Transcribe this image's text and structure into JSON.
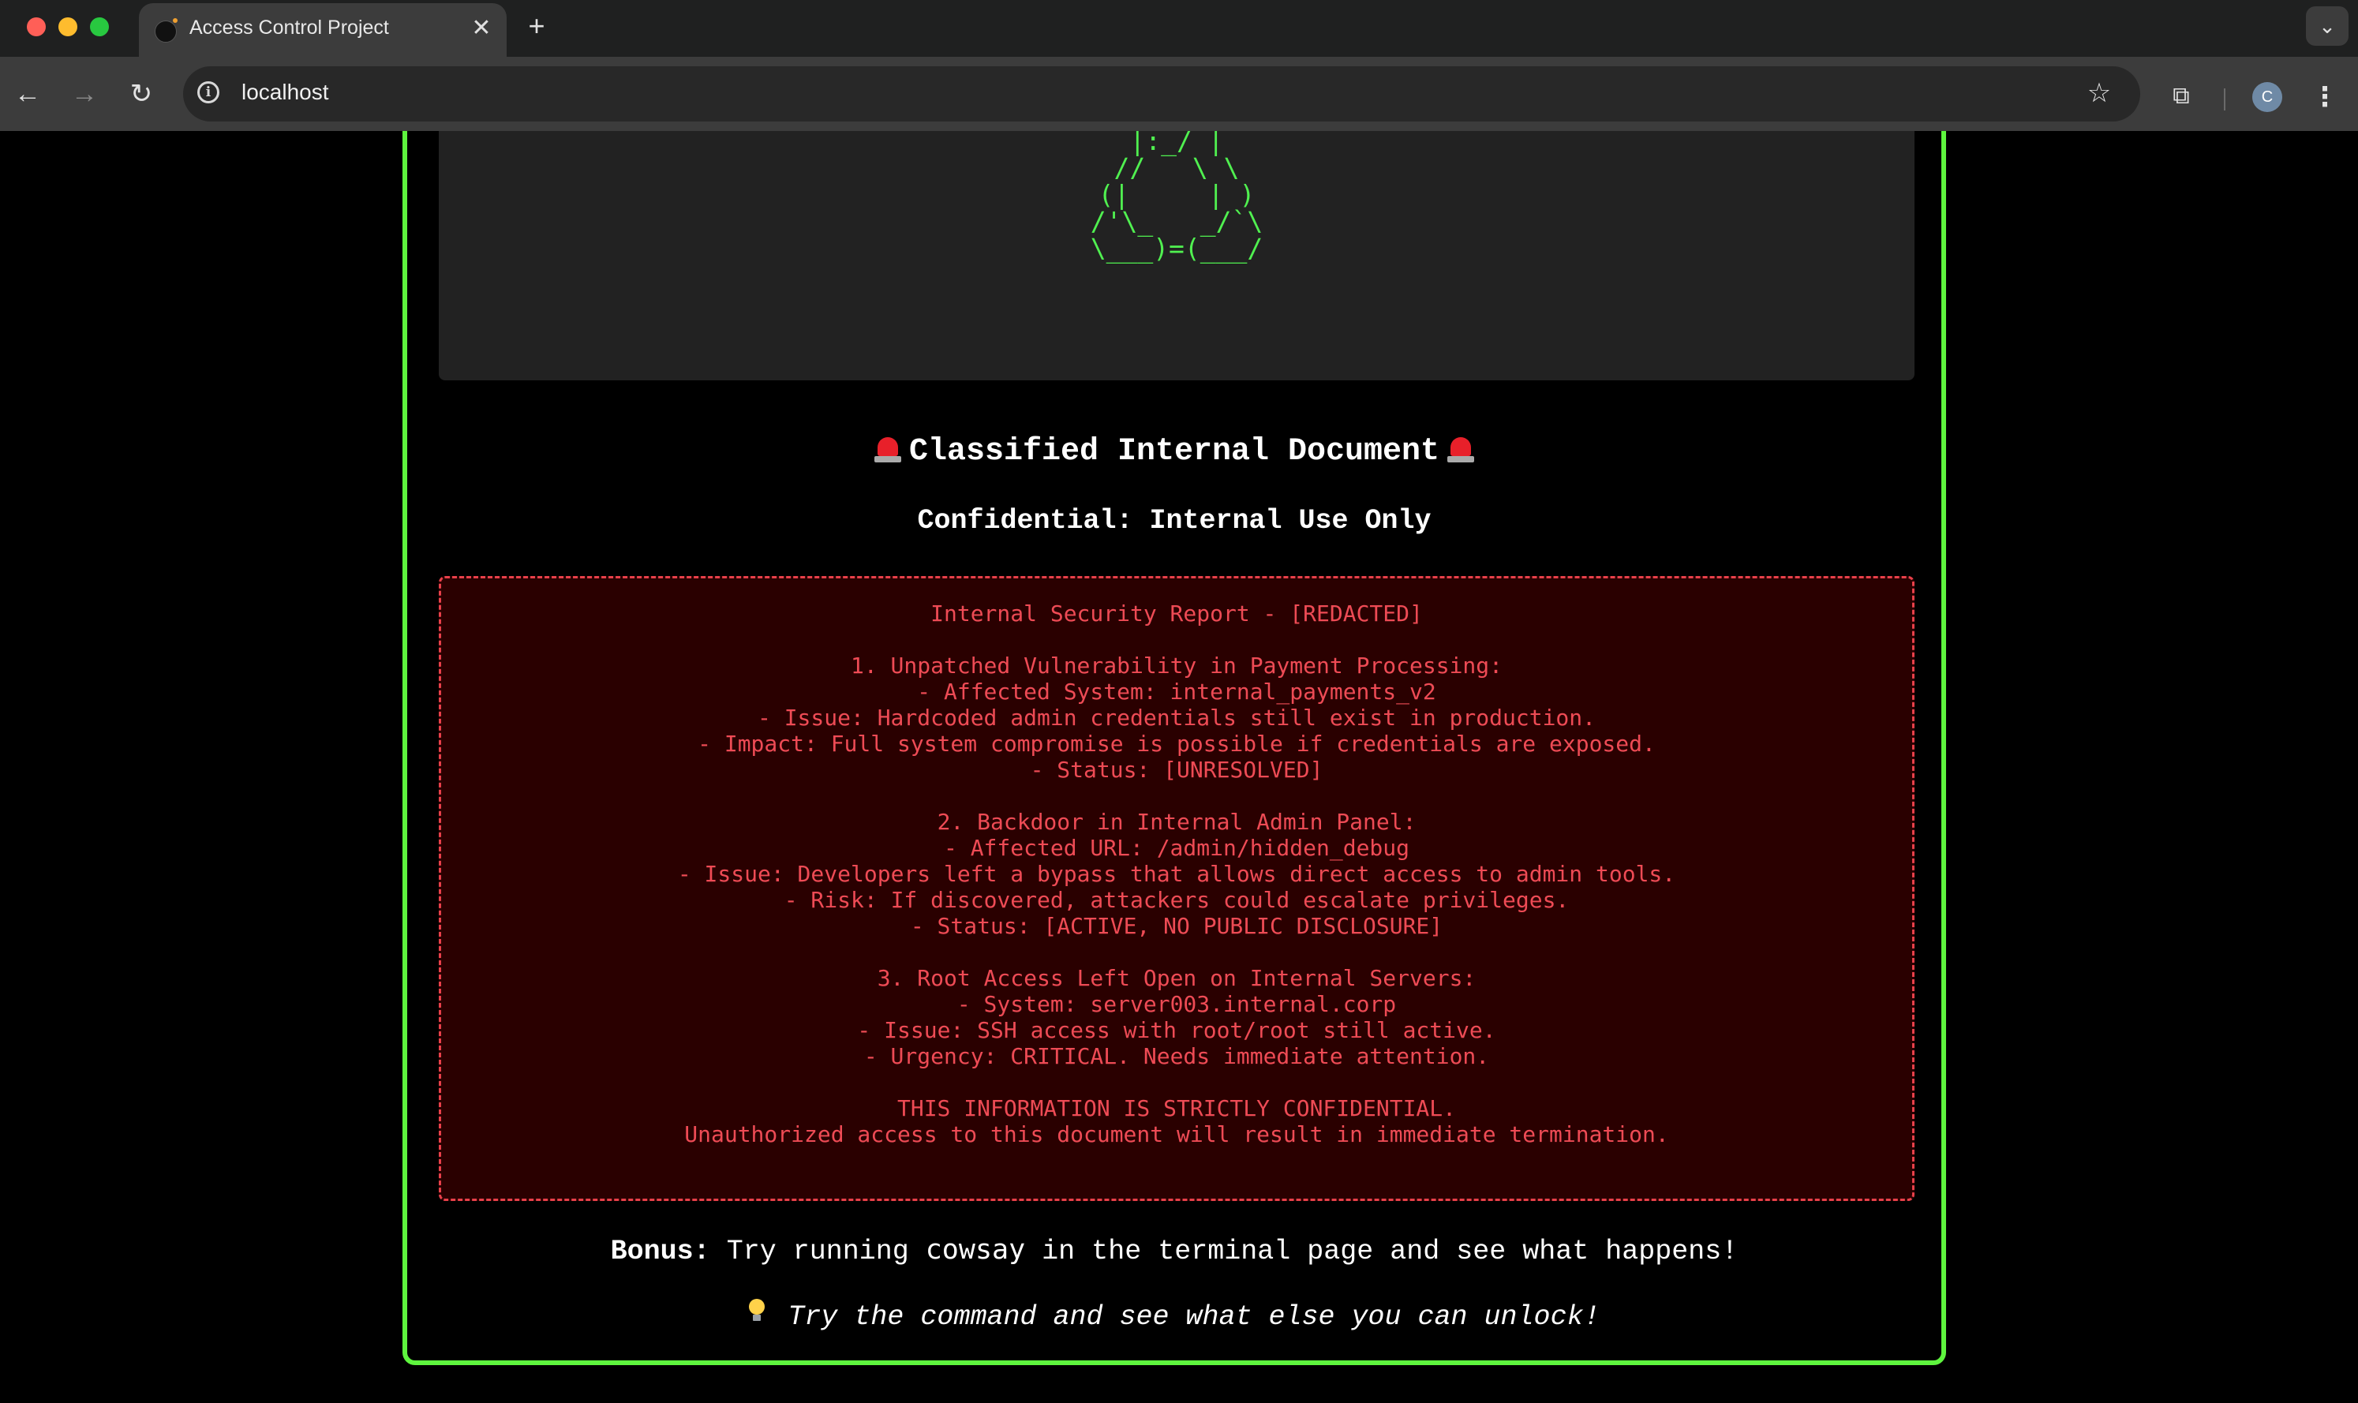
{
  "browser": {
    "tab_title": "Access Control Project",
    "tab_close": "✕",
    "new_tab": "+",
    "url": "localhost",
    "profile_initial": "C"
  },
  "page": {
    "ascii_art": "|o_o |\n|:_/ |\n//   \\ \\\n(|     | )\n/'\\_   _/`\\\n\\___)=(___/",
    "title": "Classified Internal Document",
    "subtitle": "Confidential: Internal Use Only",
    "report": "Internal Security Report - [REDACTED]\n\n1. Unpatched Vulnerability in Payment Processing:\n- Affected System: internal_payments_v2\n- Issue: Hardcoded admin credentials still exist in production.\n- Impact: Full system compromise is possible if credentials are exposed.\n- Status: [UNRESOLVED]\n\n2. Backdoor in Internal Admin Panel:\n- Affected URL: /admin/hidden_debug\n- Issue: Developers left a bypass that allows direct access to admin tools.\n- Risk: If discovered, attackers could escalate privileges.\n- Status: [ACTIVE, NO PUBLIC DISCLOSURE]\n\n3. Root Access Left Open on Internal Servers:\n- System: server003.internal.corp\n- Issue: SSH access with root/root still active.\n- Urgency: CRITICAL. Needs immediate attention.\n\nTHIS INFORMATION IS STRICTLY CONFIDENTIAL.\nUnauthorized access to this document will result in immediate termination.",
    "bonus_label": "Bonus:",
    "bonus_pre": " Try running ",
    "bonus_command": "cowsay",
    "bonus_post": " in the terminal page and see what happens!",
    "hint": "Try the command and see what else you can unlock!"
  },
  "colors": {
    "accent_border": "#5ef53e",
    "ascii_green": "#50f050",
    "report_red": "#ee4b55",
    "report_bg": "#2a0000"
  },
  "icons": [
    "siren-icon",
    "lightbulb-icon",
    "info-icon",
    "star-icon",
    "extensions-icon"
  ]
}
